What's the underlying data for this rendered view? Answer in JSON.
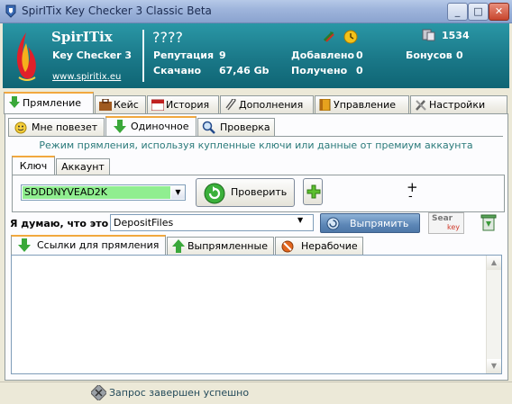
{
  "window": {
    "title": "SpirITix Key Checker 3 Classic Beta",
    "minimize": "_",
    "maximize": "□",
    "close": "✕"
  },
  "header": {
    "brand": "SpirITix",
    "subtitle": "Key Checker 3",
    "website": "www.spiritix.eu",
    "user": "????",
    "points": "1534",
    "stats": {
      "reputation_label": "Репутация",
      "reputation_value": "9",
      "downloaded_label": "Скачано",
      "downloaded_value": "67,46 Gb",
      "added_label": "Добавлено",
      "added_value": "0",
      "received_label": "Получено",
      "received_value": "0",
      "bonus_label": "Бонусов",
      "bonus_value": "0"
    }
  },
  "main_tabs": [
    {
      "label": "Прямление"
    },
    {
      "label": "Кейс"
    },
    {
      "label": "История"
    },
    {
      "label": "Дополнения"
    },
    {
      "label": "Управление"
    },
    {
      "label": "Настройки"
    }
  ],
  "sub_tabs": [
    {
      "label": "Мне повезет"
    },
    {
      "label": "Одиночное"
    },
    {
      "label": "Проверка"
    }
  ],
  "mode_text": "Режим прямления, используя купленные ключи или данные от премиум аккаунта",
  "key_tabs": [
    {
      "label": "Ключ"
    },
    {
      "label": "Аккаунт"
    }
  ],
  "key_input": {
    "value": "SDDDNYVEAD2K"
  },
  "check_button": "Проверить",
  "plus_label": "+",
  "minus_label": "-",
  "host_label": "Я думаю, что это :",
  "host_value": "DepositFiles",
  "straighten_button": "Выпрямить",
  "search_logo_top": "Sear",
  "search_logo_bottom": "key",
  "link_tabs": [
    {
      "label": "Ссылки для прямления"
    },
    {
      "label": "Выпрямленные"
    },
    {
      "label": "Нерабочие"
    }
  ],
  "status": {
    "text": "Запрос завершен успешно"
  },
  "colors": {
    "header": "#1a7888",
    "accent": "#f1a83e",
    "input_highlight": "#90ee90"
  }
}
